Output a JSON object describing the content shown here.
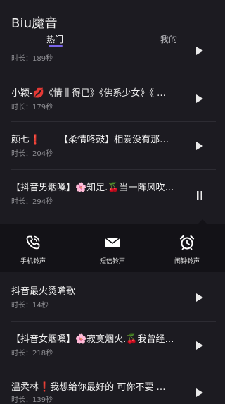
{
  "app": {
    "title": "Biu魔音"
  },
  "tabs": [
    {
      "label": "热门",
      "active": true
    },
    {
      "label": "我的",
      "active": false
    }
  ],
  "colors": {
    "accent": "#7a64e8",
    "background": "#1c1b21",
    "panel": "#131217"
  },
  "songs": [
    {
      "name": "",
      "duration": "时长：189秒"
    },
    {
      "name": "小颖-💋《情非得已》《佛系少女》《 …",
      "duration": "时长：179秒"
    },
    {
      "name": "颜七❗——【柔情咚鼓】相爱没有那…",
      "duration": "时长：204秒"
    },
    {
      "name": "【抖音男烟嗓】🌸知足.🍒当一阵风吹…",
      "duration": "时长：294秒",
      "state": "playing"
    },
    {
      "name": "抖音最火烫嘴歌",
      "duration": "时长：14秒"
    },
    {
      "name": "【抖音女烟嗓】🌸寂寞烟火.🍒我曾经…",
      "duration": "时长：218秒"
    },
    {
      "name": "温柔林❗我想给你最好的  可你不要  …",
      "duration": "时长：139秒"
    }
  ],
  "ringtone_panel": {
    "options": [
      {
        "label": "手机铃声",
        "icon": "phone-icon"
      },
      {
        "label": "短信铃声",
        "icon": "envelope-icon"
      },
      {
        "label": "闹钟铃声",
        "icon": "alarm-clock-icon"
      }
    ]
  }
}
